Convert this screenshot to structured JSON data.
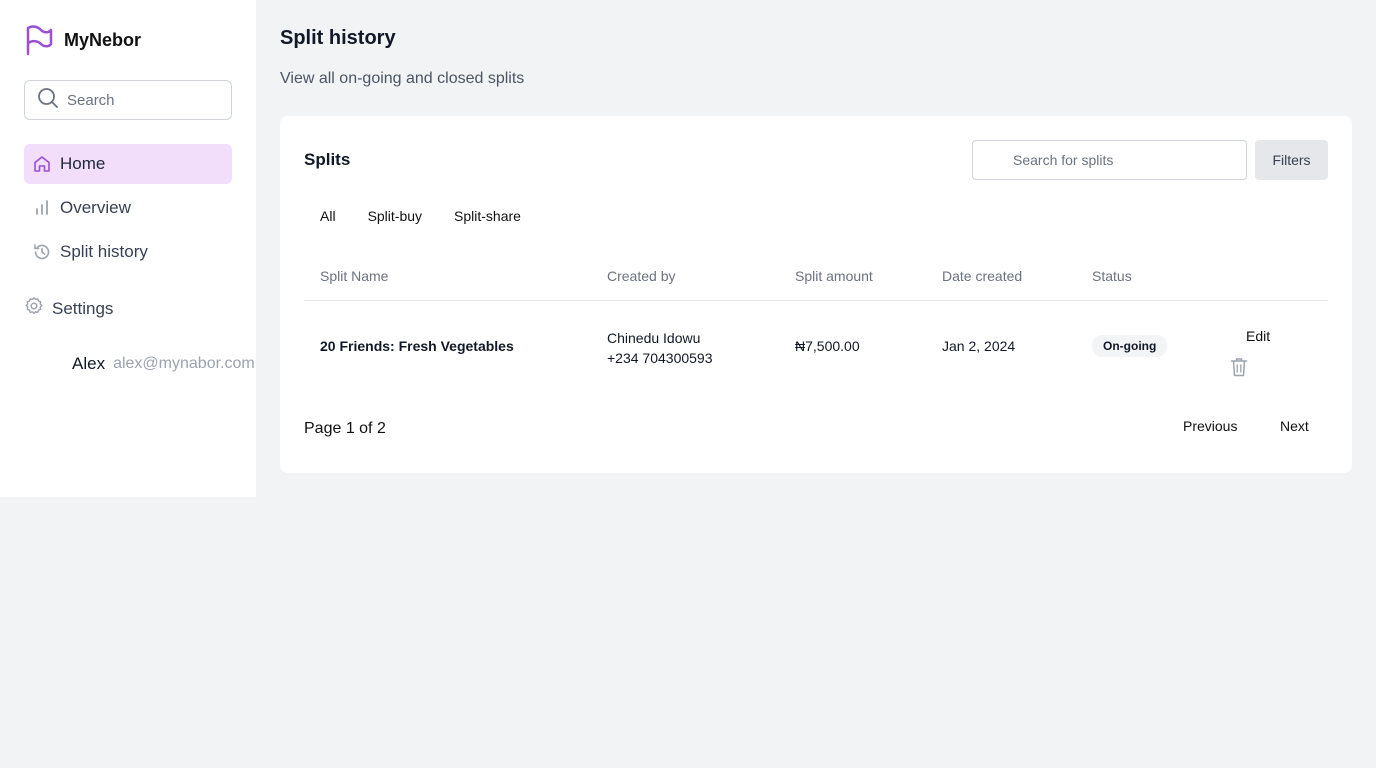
{
  "app": {
    "name": "MyNebor",
    "brand_color": "#9b4fd1"
  },
  "sidebar": {
    "search_placeholder": "Search",
    "items": [
      {
        "label": "Home",
        "icon": "home-icon",
        "active": true
      },
      {
        "label": "Overview",
        "icon": "bar-chart-icon",
        "active": false
      },
      {
        "label": "Split history",
        "icon": "history-icon",
        "active": false
      }
    ],
    "settings_label": "Settings",
    "user": {
      "name": "Alex",
      "email": "alex@mynabor.com"
    }
  },
  "page": {
    "title": "Split history",
    "subtitle": "View all on-going and closed splits"
  },
  "card": {
    "title": "Splits",
    "search_placeholder": "Search for splits",
    "filters_label": "Filters",
    "tabs": [
      "All",
      "Split-buy",
      "Split-share"
    ],
    "columns": [
      "Split Name",
      "Created by",
      "Split amount",
      "Date created",
      "Status"
    ],
    "rows": [
      {
        "split_name": "20 Friends: Fresh Vegetables",
        "creator_name": "Chinedu Idowu",
        "creator_phone": "+234 704300593",
        "amount": "₦7,500.00",
        "date": "Jan 2, 2024",
        "status": "On-going",
        "edit_label": "Edit"
      }
    ],
    "pagination": {
      "text": "Page 1 of 2",
      "previous_label": "Previous",
      "next_label": "Next"
    }
  }
}
